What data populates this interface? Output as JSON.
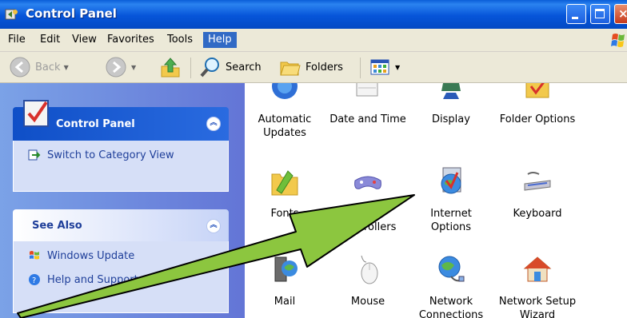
{
  "window": {
    "title": "Control Panel"
  },
  "menu": [
    "File",
    "Edit",
    "View",
    "Favorites",
    "Tools",
    "Help"
  ],
  "menu_active": "Help",
  "toolbar": {
    "back": "Back",
    "search": "Search",
    "folders": "Folders"
  },
  "left": {
    "control_panel": {
      "title": "Control Panel",
      "task": "Switch to Category View"
    },
    "see_also": {
      "title": "See Also",
      "items": [
        "Windows Update",
        "Help and Support"
      ]
    }
  },
  "items": [
    {
      "label": "Automatic Updates",
      "icon": "automatic-updates-icon"
    },
    {
      "label": "Date and Time",
      "icon": "date-and-time-icon"
    },
    {
      "label": "Display",
      "icon": "display-icon"
    },
    {
      "label": "Folder Options",
      "icon": "folder-options-icon"
    },
    {
      "label": "Fonts",
      "icon": "fonts-icon"
    },
    {
      "label": "Game Controllers",
      "icon": "game-controllers-icon"
    },
    {
      "label": "Internet Options",
      "icon": "internet-options-icon"
    },
    {
      "label": "Keyboard",
      "icon": "keyboard-icon"
    },
    {
      "label": "Mail",
      "icon": "mail-icon"
    },
    {
      "label": "Mouse",
      "icon": "mouse-icon"
    },
    {
      "label": "Network Connections",
      "icon": "network-connections-icon"
    },
    {
      "label": "Network Setup Wizard",
      "icon": "network-setup-wizard-icon"
    }
  ],
  "colors": {
    "title_blue": "#0655d9",
    "pane_blue": "#6375d6",
    "arrow_green": "#8cc63f",
    "menu_highlight": "#316ac5"
  }
}
